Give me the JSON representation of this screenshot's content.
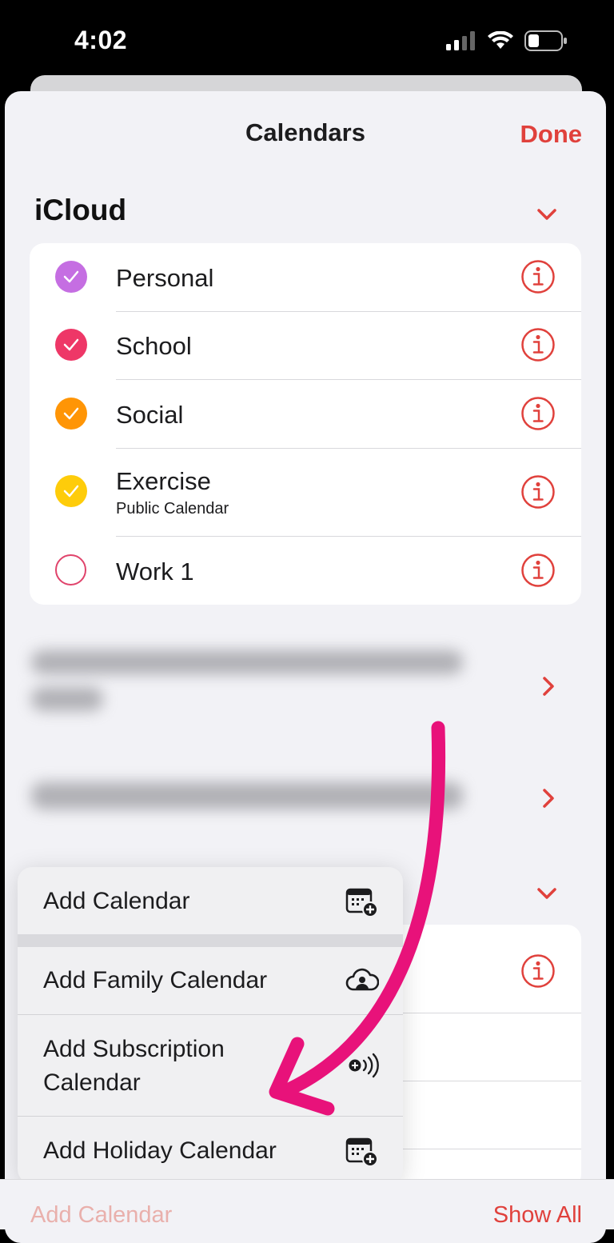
{
  "status_bar": {
    "time": "4:02",
    "icons": [
      "signal-icon",
      "wifi-icon",
      "battery-icon"
    ]
  },
  "header": {
    "title": "Calendars",
    "done_label": "Done"
  },
  "icloud": {
    "title": "iCloud",
    "calendars": [
      {
        "name": "Personal",
        "color": "#c56ee2",
        "checked": true
      },
      {
        "name": "School",
        "color": "#ee3767",
        "checked": true
      },
      {
        "name": "Social",
        "color": "#ff9506",
        "checked": true
      },
      {
        "name": "Exercise",
        "subtitle": "Public Calendar",
        "color": "#fecc0a",
        "checked": true
      },
      {
        "name": "Work 1",
        "color": "#e0436b",
        "checked": false
      }
    ]
  },
  "popup_menu": {
    "items": [
      {
        "label": "Add Calendar",
        "icon": "calendar-plus-icon"
      },
      {
        "label": "Add Family Calendar",
        "icon": "family-cloud-icon"
      },
      {
        "label": "Add Subscription Calendar",
        "icon": "subscription-icon"
      },
      {
        "label": "Add Holiday Calendar",
        "icon": "calendar-plus-icon"
      }
    ]
  },
  "bottom_bar": {
    "add_calendar_label": "Add Calendar",
    "show_all_label": "Show All"
  },
  "colors": {
    "accent": "#e0413c",
    "annotation_arrow": "#e8127a"
  }
}
